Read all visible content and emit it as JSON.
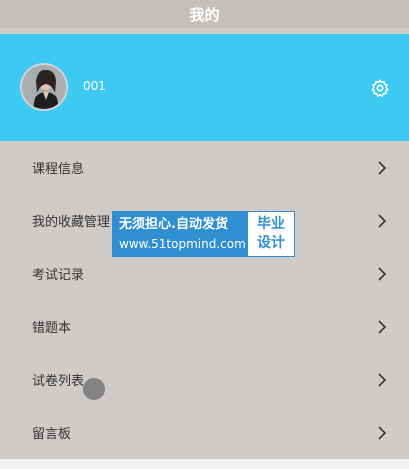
{
  "header": {
    "title": "我的"
  },
  "profile": {
    "username": "001",
    "settings_icon": "gear-icon",
    "accent": "#3dc9f1"
  },
  "menu": {
    "items": [
      {
        "label": "课程信息",
        "icon": "chevron-right-icon"
      },
      {
        "label": "我的收藏管理",
        "icon": "chevron-right-icon"
      },
      {
        "label": "考试记录",
        "icon": "chevron-right-icon"
      },
      {
        "label": "错题本",
        "icon": "chevron-right-icon"
      },
      {
        "label": "试卷列表",
        "icon": "chevron-right-icon"
      },
      {
        "label": "留言板",
        "icon": "chevron-right-icon"
      }
    ]
  },
  "watermark": {
    "line1": "无须担心.自动发货",
    "line2": "www.51topmind.com",
    "badge_line1": "毕业",
    "badge_line2": "设计"
  }
}
